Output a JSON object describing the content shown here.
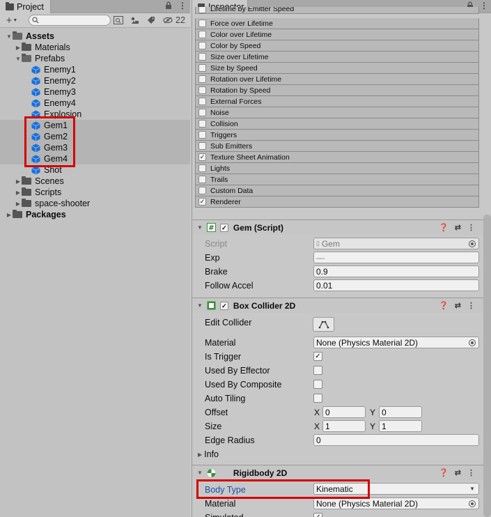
{
  "project": {
    "tab_title": "Project",
    "lock_icon": "lock-icon",
    "menu_icon": "kebab-menu-icon",
    "toolbar": {
      "add_label": "+",
      "search_placeholder": "",
      "hidden_count": "22"
    },
    "tree": [
      {
        "label": "Assets",
        "depth": 0,
        "type": "folder",
        "expanded": true,
        "bold": true
      },
      {
        "label": "Materials",
        "depth": 1,
        "type": "folder",
        "expanded": false
      },
      {
        "label": "Prefabs",
        "depth": 1,
        "type": "folder",
        "expanded": true
      },
      {
        "label": "Enemy1",
        "depth": 2,
        "type": "prefab"
      },
      {
        "label": "Enemy2",
        "depth": 2,
        "type": "prefab"
      },
      {
        "label": "Enemy3",
        "depth": 2,
        "type": "prefab"
      },
      {
        "label": "Enemy4",
        "depth": 2,
        "type": "prefab"
      },
      {
        "label": "Explosion",
        "depth": 2,
        "type": "prefab"
      },
      {
        "label": "Gem1",
        "depth": 2,
        "type": "prefab",
        "selected": true
      },
      {
        "label": "Gem2",
        "depth": 2,
        "type": "prefab",
        "selected": true
      },
      {
        "label": "Gem3",
        "depth": 2,
        "type": "prefab",
        "selected": true
      },
      {
        "label": "Gem4",
        "depth": 2,
        "type": "prefab",
        "selected": true
      },
      {
        "label": "Shot",
        "depth": 2,
        "type": "prefab"
      },
      {
        "label": "Scenes",
        "depth": 1,
        "type": "folder",
        "expanded": false
      },
      {
        "label": "Scripts",
        "depth": 1,
        "type": "folder",
        "expanded": false
      },
      {
        "label": "space-shooter",
        "depth": 1,
        "type": "folder",
        "expanded": false
      },
      {
        "label": "Packages",
        "depth": 0,
        "type": "folder",
        "expanded": false,
        "bold": true
      }
    ]
  },
  "inspector": {
    "tab_title": "Inspector",
    "particle_modules": [
      {
        "label": "Lifetime by Emitter Speed",
        "checked": false
      },
      {
        "label": "Force over Lifetime",
        "checked": false
      },
      {
        "label": "Color over Lifetime",
        "checked": false
      },
      {
        "label": "Color by Speed",
        "checked": false
      },
      {
        "label": "Size over Lifetime",
        "checked": false
      },
      {
        "label": "Size by Speed",
        "checked": false
      },
      {
        "label": "Rotation over Lifetime",
        "checked": false
      },
      {
        "label": "Rotation by Speed",
        "checked": false
      },
      {
        "label": "External Forces",
        "checked": false
      },
      {
        "label": "Noise",
        "checked": false
      },
      {
        "label": "Collision",
        "checked": false
      },
      {
        "label": "Triggers",
        "checked": false
      },
      {
        "label": "Sub Emitters",
        "checked": false
      },
      {
        "label": "Texture Sheet Animation",
        "checked": true
      },
      {
        "label": "Lights",
        "checked": false
      },
      {
        "label": "Trails",
        "checked": false
      },
      {
        "label": "Custom Data",
        "checked": false
      },
      {
        "label": "Renderer",
        "checked": true
      }
    ],
    "gem_script": {
      "title": "Gem (Script)",
      "script_label": "Script",
      "script_value": "Gem",
      "exp_label": "Exp",
      "exp_value": "—",
      "brake_label": "Brake",
      "brake_value": "0.9",
      "follow_label": "Follow Accel",
      "follow_value": "0.01"
    },
    "box_collider": {
      "title": "Box Collider 2D",
      "edit_collider_label": "Edit Collider",
      "material_label": "Material",
      "material_value": "None (Physics Material 2D)",
      "is_trigger_label": "Is Trigger",
      "is_trigger": true,
      "used_by_effector_label": "Used By Effector",
      "used_by_composite_label": "Used By Composite",
      "auto_tiling_label": "Auto Tiling",
      "offset_label": "Offset",
      "offset_x": "0",
      "offset_y": "0",
      "size_label": "Size",
      "size_x": "1",
      "size_y": "1",
      "edge_radius_label": "Edge Radius",
      "edge_radius_value": "0",
      "info_label": "Info",
      "x_label": "X",
      "y_label": "Y"
    },
    "rigidbody": {
      "title": "Rigidbody 2D",
      "body_type_label": "Body Type",
      "body_type_value": "Kinematic",
      "material_label": "Material",
      "material_value": "None (Physics Material 2D)",
      "simulated_label": "Simulated"
    }
  },
  "colors": {
    "highlight_red": "#d40000",
    "selection_bg": "#b4b4b4",
    "prefab_blue": "#1c6fd6",
    "body_type_label_blue": "#1a4fa8"
  }
}
